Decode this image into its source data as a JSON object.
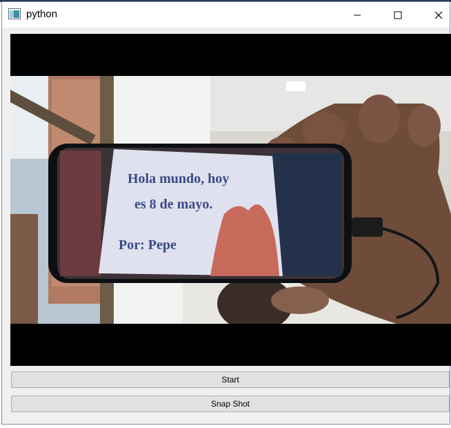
{
  "window": {
    "title": "python"
  },
  "video": {
    "note_lines": [
      "Hola mundo, hoy",
      "es 8 de mayo.",
      "Por: Pepe"
    ]
  },
  "buttons": {
    "start": "Start",
    "snapshot": "Snap Shot"
  },
  "icons": {
    "app": "window-icon",
    "minimize": "minimize-icon",
    "maximize": "maximize-icon",
    "close": "close-icon"
  }
}
